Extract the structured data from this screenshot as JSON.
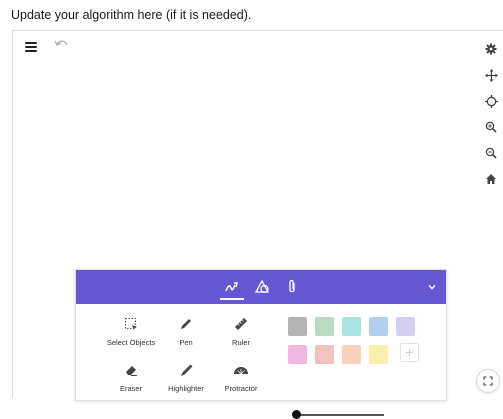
{
  "prompt": {
    "text": "Update your algorithm here (if it is needed)."
  },
  "toolbar": {
    "menu_icon": "hamburger-menu-icon",
    "undo_icon": "undo-icon",
    "right_icons": [
      "gear-icon",
      "move-icon",
      "crosshair-icon",
      "zoom-in-icon",
      "zoom-out-icon",
      "home-icon"
    ],
    "fullscreen_icon": "fullscreen-icon"
  },
  "panel": {
    "accent": "#6557d2",
    "tabs": [
      "draw-tools-icon",
      "shapes-icon",
      "attachment-icon"
    ],
    "active_tab": 0,
    "tools": [
      {
        "label": "Select Objects",
        "icon": "select-objects-icon"
      },
      {
        "label": "Pen",
        "icon": "pen-icon"
      },
      {
        "label": "Ruler",
        "icon": "ruler-icon"
      },
      {
        "label": "Eraser",
        "icon": "eraser-icon"
      },
      {
        "label": "Highlighter",
        "icon": "highlighter-icon"
      },
      {
        "label": "Protractor",
        "icon": "protractor-icon"
      }
    ],
    "colors": [
      [
        "#b3b3b3",
        "#b9dbc3",
        "#a9e3e0",
        "#b3cff0",
        "#d2cff2"
      ],
      [
        "#f2b6e2",
        "#f4c1c1",
        "#f8d1bc",
        "#fbefa9"
      ]
    ],
    "add_color_icon": "plus-icon",
    "stroke_size": 0.02
  }
}
